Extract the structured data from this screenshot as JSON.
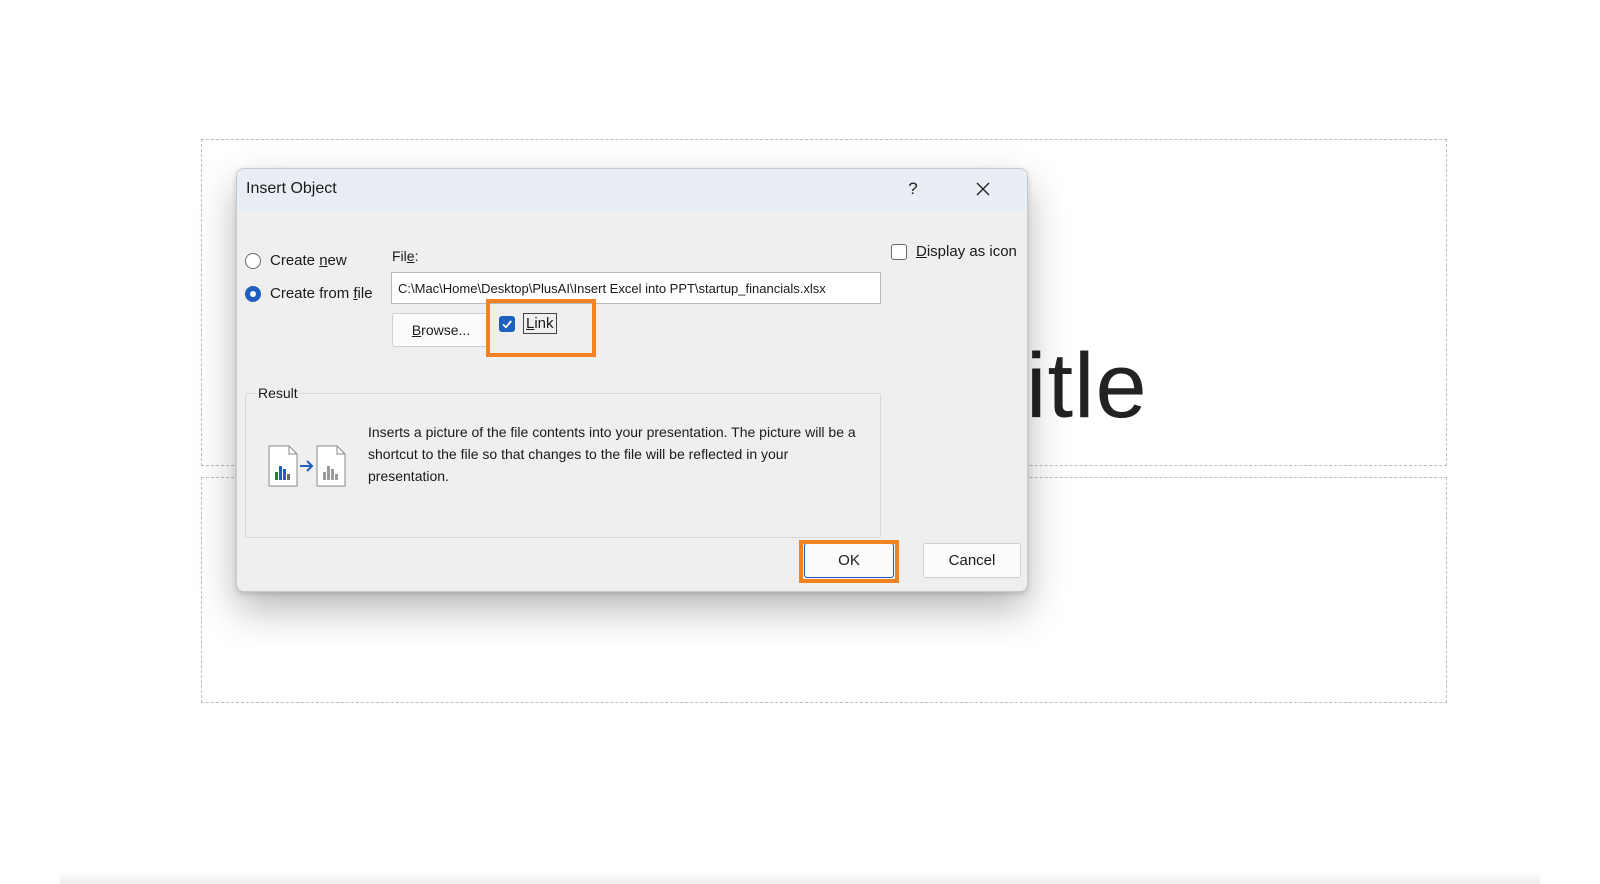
{
  "slide": {
    "title_fragment": "itle"
  },
  "dialog": {
    "title": "Insert Object",
    "help_label": "?",
    "options": {
      "create_new": {
        "pre": "Create ",
        "key": "n",
        "post": "ew",
        "selected": false
      },
      "create_from_file": {
        "pre": "Create from ",
        "key": "f",
        "post": "ile",
        "selected": true
      }
    },
    "file_label": {
      "pre": "Fil",
      "key": "e",
      "post": ":"
    },
    "file_path": "C:\\Mac\\Home\\Desktop\\PlusAI\\Insert Excel into PPT\\startup_financials.xlsx",
    "browse_button": {
      "pre": "",
      "key": "B",
      "post": "rowse..."
    },
    "link_checkbox": {
      "pre": "",
      "key": "L",
      "post": "ink",
      "checked": true
    },
    "display_as_icon": {
      "pre": "",
      "key": "D",
      "post": "isplay as icon",
      "checked": false
    },
    "result": {
      "legend": "Result",
      "description": "Inserts a picture of the file contents into your presentation. The picture will be a shortcut to the file so that changes to the file will be reflected in your presentation."
    },
    "ok_label": "OK",
    "cancel_label": "Cancel"
  },
  "colors": {
    "accent": "#1f5fbf",
    "highlight": "#f58220",
    "titlebar": "#e9eef5",
    "dialog_bg": "#efefef"
  }
}
